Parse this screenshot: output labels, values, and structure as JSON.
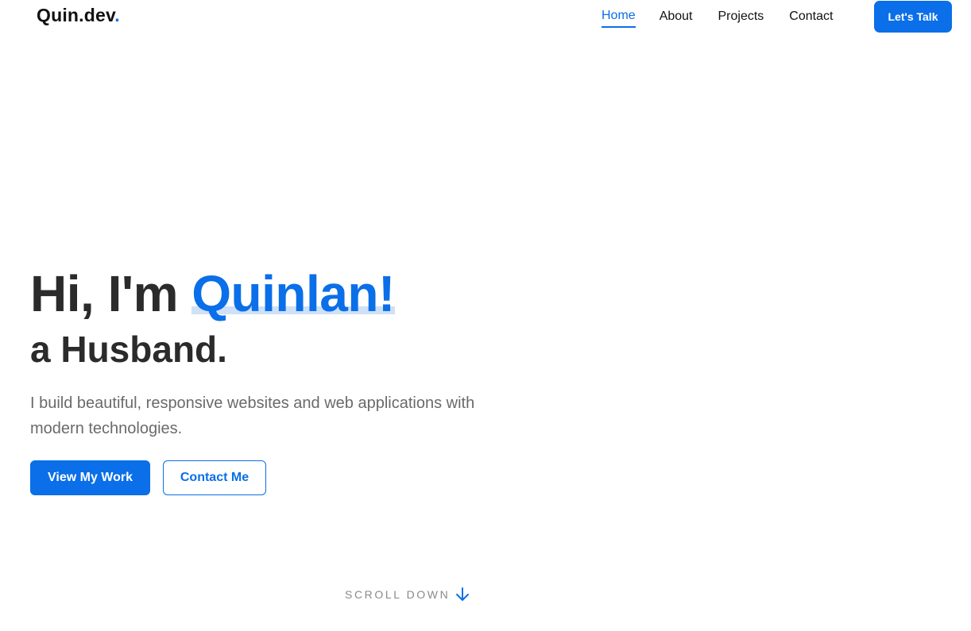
{
  "header": {
    "logo_text": "Quin.dev",
    "logo_dot": ".",
    "nav": [
      {
        "label": "Home",
        "active": true
      },
      {
        "label": "About",
        "active": false
      },
      {
        "label": "Projects",
        "active": false
      },
      {
        "label": "Contact",
        "active": false
      }
    ],
    "cta_label": "Let's Talk"
  },
  "hero": {
    "greeting": "Hi, I'm ",
    "name": "Quinlan!",
    "role": "a Husband.",
    "description": "I build beautiful, responsive websites and web applications with modern technologies.",
    "primary_button": "View My Work",
    "secondary_button": "Contact Me"
  },
  "scroll": {
    "label": "SCROLL DOWN",
    "icon": "arrow-down-icon"
  },
  "colors": {
    "accent": "#0a6fe8",
    "heading": "#2b2b2b",
    "body_text": "#6a6a6a",
    "name_underline": "#cfe0f7"
  }
}
